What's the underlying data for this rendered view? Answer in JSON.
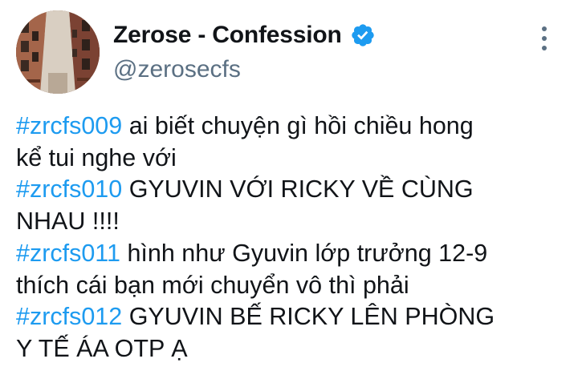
{
  "tweet": {
    "display_name": "Zerose - Confession",
    "handle": "@zerosecfs",
    "verified": true,
    "accent_color": "#1d9bf0",
    "avatar_icon": "street-photo-avatar",
    "more_icon": "more-vertical-icon",
    "lines": [
      {
        "hashtag": "#zrcfs009",
        "text": " ai biết chuyện gì hồi chiều hong"
      },
      {
        "hashtag": "",
        "text": "kể tui nghe với"
      },
      {
        "hashtag": "#zrcfs010",
        "text": " GYUVIN VỚI RICKY VỀ CÙNG"
      },
      {
        "hashtag": "",
        "text": "NHAU !!!!"
      },
      {
        "hashtag": "#zrcfs011",
        "text": " hình như Gyuvin lớp trưởng 12-9"
      },
      {
        "hashtag": "",
        "text": "thích cái bạn mới chuyển vô thì phải"
      },
      {
        "hashtag": "#zrcfs012",
        "text": " GYUVIN BẾ RICKY LÊN PHÒNG"
      },
      {
        "hashtag": "",
        "text": "Y TẾ ÁA OTP Ạ"
      }
    ]
  }
}
